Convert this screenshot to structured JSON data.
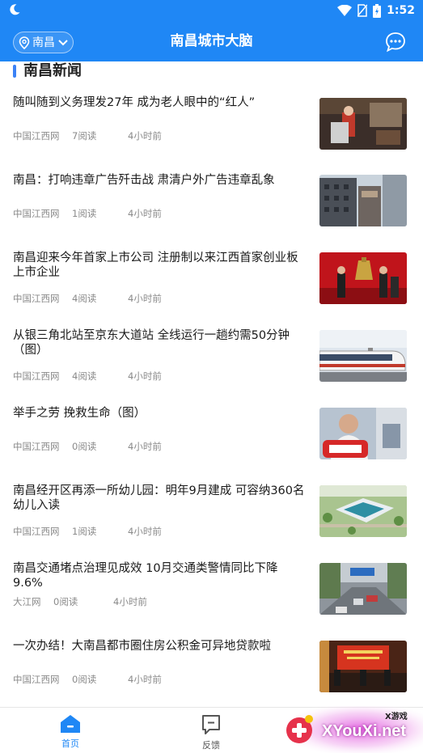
{
  "status_bar": {
    "time": "1:52"
  },
  "app_bar": {
    "city": "南昌",
    "title": "南昌城市大脑",
    "icons": {
      "location": "location-pin-icon",
      "dropdown": "chevron-down-icon",
      "chat": "chat-bubble-icon"
    }
  },
  "section": {
    "title": "南昌新闻"
  },
  "news": [
    {
      "title": "随叫随到义务理发27年 成为老人眼中的“红人”",
      "source": "中国江西网",
      "reads": "7阅读",
      "time": "4小时前"
    },
    {
      "title": "南昌：打响违章广告歼击战 肃清户外广告违章乱象",
      "source": "中国江西网",
      "reads": "1阅读",
      "time": "4小时前"
    },
    {
      "title": "南昌迎来今年首家上市公司 注册制以来江西首家创业板上市企业",
      "source": "中国江西网",
      "reads": "4阅读",
      "time": "4小时前"
    },
    {
      "title": "从银三角北站至京东大道站 全线运行一趟约需50分钟（图）",
      "source": "中国江西网",
      "reads": "4阅读",
      "time": "4小时前"
    },
    {
      "title": "举手之劳 挽救生命（图）",
      "source": "中国江西网",
      "reads": "0阅读",
      "time": "4小时前"
    },
    {
      "title": "南昌经开区再添一所幼儿园：明年9月建成 可容纳360名幼儿入读",
      "source": "中国江西网",
      "reads": "1阅读",
      "time": "4小时前"
    },
    {
      "title": "南昌交通堵点治理见成效 10月交通类警情同比下降9.6%",
      "source": "大江网",
      "reads": "0阅读",
      "time": "4小时前"
    },
    {
      "title": "一次办结！大南昌都市圈住房公积金可异地贷款啦",
      "source": "中国江西网",
      "reads": "0阅读",
      "time": "4小时前"
    }
  ],
  "tabs": [
    {
      "label": "首页",
      "icon": "home-icon"
    },
    {
      "label": "反馈",
      "icon": "feedback-icon"
    }
  ],
  "watermark": {
    "text": "XYouXi.net",
    "sub": "X游戏"
  },
  "colors": {
    "primary": "#1f87f5",
    "accent_bar": "#3b82f6",
    "meta_text": "#8a8a8a"
  }
}
